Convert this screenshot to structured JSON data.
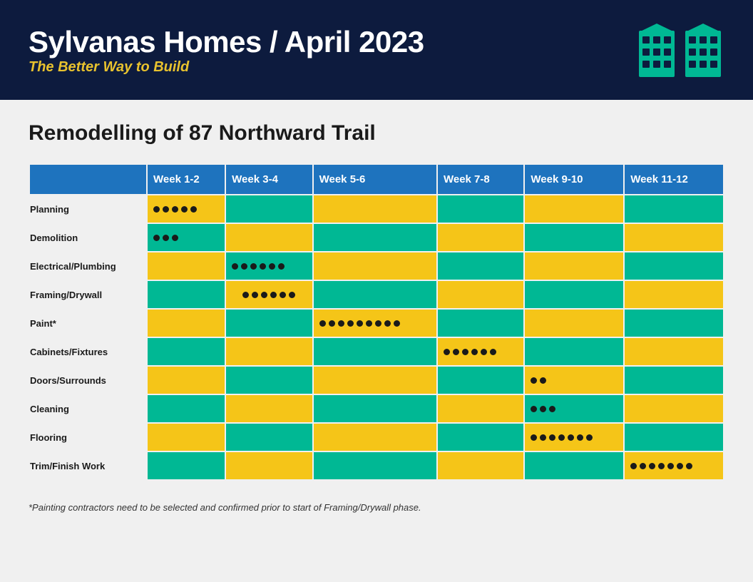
{
  "header": {
    "title": "Sylvanas Homes / April 2023",
    "subtitle": "The Better Way to Build"
  },
  "project": {
    "title": "Remodelling of 87 Northward Trail"
  },
  "table": {
    "columns": [
      "",
      "Week 1-2",
      "Week 3-4",
      "Week 5-6",
      "Week 7-8",
      "Week 9-10",
      "Week 11-12"
    ],
    "rows": [
      {
        "label": "Planning",
        "cells": [
          {
            "type": "dots",
            "count": 5,
            "bg": "yellow"
          },
          {
            "type": "empty",
            "bg": "teal"
          },
          {
            "type": "empty",
            "bg": "yellow"
          },
          {
            "type": "empty",
            "bg": "teal"
          },
          {
            "type": "empty",
            "bg": "yellow"
          },
          {
            "type": "empty",
            "bg": "teal"
          }
        ]
      },
      {
        "label": "Demolition",
        "cells": [
          {
            "type": "dots",
            "count": 3,
            "bg": "teal"
          },
          {
            "type": "empty",
            "bg": "yellow"
          },
          {
            "type": "empty",
            "bg": "teal"
          },
          {
            "type": "empty",
            "bg": "yellow"
          },
          {
            "type": "empty",
            "bg": "teal"
          },
          {
            "type": "empty",
            "bg": "yellow"
          }
        ]
      },
      {
        "label": "Electrical/Plumbing",
        "cells": [
          {
            "type": "empty",
            "bg": "yellow"
          },
          {
            "type": "dots",
            "count": 6,
            "bg": "teal"
          },
          {
            "type": "empty",
            "bg": "yellow"
          },
          {
            "type": "empty",
            "bg": "teal"
          },
          {
            "type": "empty",
            "bg": "yellow"
          },
          {
            "type": "empty",
            "bg": "teal"
          }
        ]
      },
      {
        "label": "Framing/Drywall",
        "cells": [
          {
            "type": "empty",
            "bg": "teal"
          },
          {
            "type": "dots-split",
            "count1": 3,
            "count2": 3,
            "bg": "yellow"
          },
          {
            "type": "empty",
            "bg": "teal"
          },
          {
            "type": "empty",
            "bg": "yellow"
          },
          {
            "type": "empty",
            "bg": "teal"
          },
          {
            "type": "empty",
            "bg": "yellow"
          }
        ]
      },
      {
        "label": "Paint*",
        "cells": [
          {
            "type": "empty",
            "bg": "yellow"
          },
          {
            "type": "empty",
            "bg": "teal"
          },
          {
            "type": "dots-cross",
            "count1": 6,
            "count2": 3,
            "bg": "yellow"
          },
          {
            "type": "empty",
            "bg": "teal"
          },
          {
            "type": "empty",
            "bg": "yellow"
          },
          {
            "type": "empty",
            "bg": "teal"
          }
        ]
      },
      {
        "label": "Cabinets/Fixtures",
        "cells": [
          {
            "type": "empty",
            "bg": "teal"
          },
          {
            "type": "empty",
            "bg": "yellow"
          },
          {
            "type": "empty",
            "bg": "teal"
          },
          {
            "type": "dots",
            "count": 6,
            "bg": "yellow"
          },
          {
            "type": "empty",
            "bg": "teal"
          },
          {
            "type": "empty",
            "bg": "yellow"
          }
        ]
      },
      {
        "label": "Doors/Surrounds",
        "cells": [
          {
            "type": "empty",
            "bg": "yellow"
          },
          {
            "type": "empty",
            "bg": "teal"
          },
          {
            "type": "empty",
            "bg": "yellow"
          },
          {
            "type": "empty",
            "bg": "teal"
          },
          {
            "type": "dots",
            "count": 2,
            "bg": "yellow"
          },
          {
            "type": "empty",
            "bg": "teal"
          }
        ]
      },
      {
        "label": "Cleaning",
        "cells": [
          {
            "type": "empty",
            "bg": "teal"
          },
          {
            "type": "empty",
            "bg": "yellow"
          },
          {
            "type": "empty",
            "bg": "teal"
          },
          {
            "type": "empty",
            "bg": "yellow"
          },
          {
            "type": "dots",
            "count": 3,
            "bg": "teal"
          },
          {
            "type": "empty",
            "bg": "yellow"
          }
        ]
      },
      {
        "label": "Flooring",
        "cells": [
          {
            "type": "empty",
            "bg": "yellow"
          },
          {
            "type": "empty",
            "bg": "teal"
          },
          {
            "type": "empty",
            "bg": "yellow"
          },
          {
            "type": "empty",
            "bg": "teal"
          },
          {
            "type": "dots-cross2",
            "count1": 4,
            "count2": 3,
            "bg": "yellow"
          },
          {
            "type": "empty",
            "bg": "teal"
          }
        ]
      },
      {
        "label": "Trim/Finish Work",
        "cells": [
          {
            "type": "empty",
            "bg": "teal"
          },
          {
            "type": "empty",
            "bg": "yellow"
          },
          {
            "type": "empty",
            "bg": "teal"
          },
          {
            "type": "empty",
            "bg": "yellow"
          },
          {
            "type": "empty",
            "bg": "teal"
          },
          {
            "type": "dots",
            "count": 7,
            "bg": "yellow"
          }
        ]
      }
    ]
  },
  "footnote": "*Painting contractors need to be selected and confirmed prior to start of Framing/Drywall phase."
}
